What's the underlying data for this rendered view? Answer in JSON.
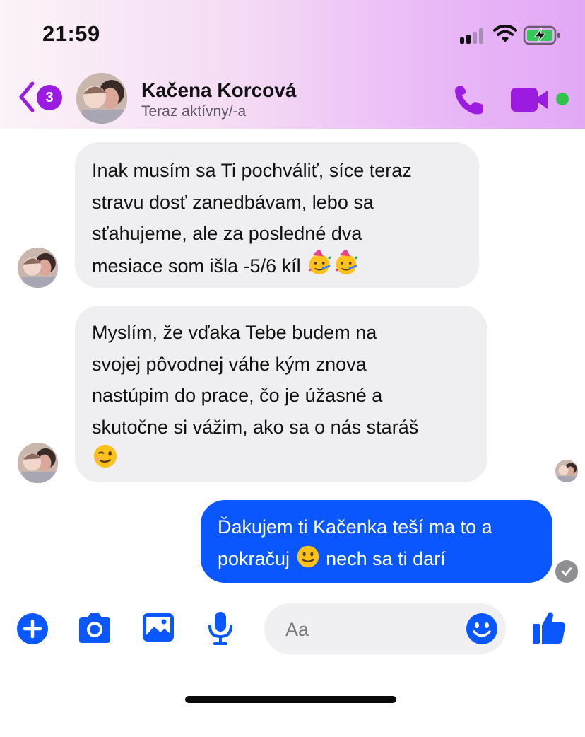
{
  "status_bar": {
    "time": "21:59",
    "icons": [
      "cellular-signal-icon",
      "wifi-icon",
      "battery-charging-icon"
    ]
  },
  "header": {
    "unread_count": "3",
    "contact_name": "Kačena Korcová",
    "contact_status": "Teraz aktívny/-a",
    "icons": [
      "back-chevron-icon",
      "avatar",
      "phone-icon",
      "video-camera-icon",
      "online-dot"
    ],
    "accent_color": "#9b1be0"
  },
  "messages": [
    {
      "direction": "incoming",
      "lines": [
        "Inak musím sa Ti pochváliť, síce teraz",
        "stravu dosť zanedbávam, lebo sa",
        "sťahujeme, ale za posledné dva",
        "mesiace som išla -5/6 kíl"
      ],
      "emojis": [
        "partying-face-emoji",
        "partying-face-emoji"
      ]
    },
    {
      "direction": "incoming",
      "lines": [
        "Myslím, že  vďaka Tebe budem na",
        "svojej pôvodnej váhe kým znova",
        "nastúpim do prace, čo je úžasné a",
        "skutočne si vážim, ako sa o nás staráš"
      ],
      "emojis": [
        "winking-face-emoji"
      ]
    },
    {
      "direction": "outgoing",
      "line1": "Ďakujem ti Kačenka teší ma to a",
      "line2_before": "pokračuj",
      "line2_after": "nech sa ti darí",
      "emojis": [
        "slightly-smiling-face-emoji"
      ],
      "status": "read-receipt-icon"
    }
  ],
  "composer": {
    "placeholder": "Aa",
    "value": "",
    "icons": [
      "plus-icon",
      "camera-icon",
      "image-icon",
      "microphone-icon",
      "emoji-icon",
      "thumbs-up-icon"
    ],
    "accent_color": "#0a57ff"
  }
}
